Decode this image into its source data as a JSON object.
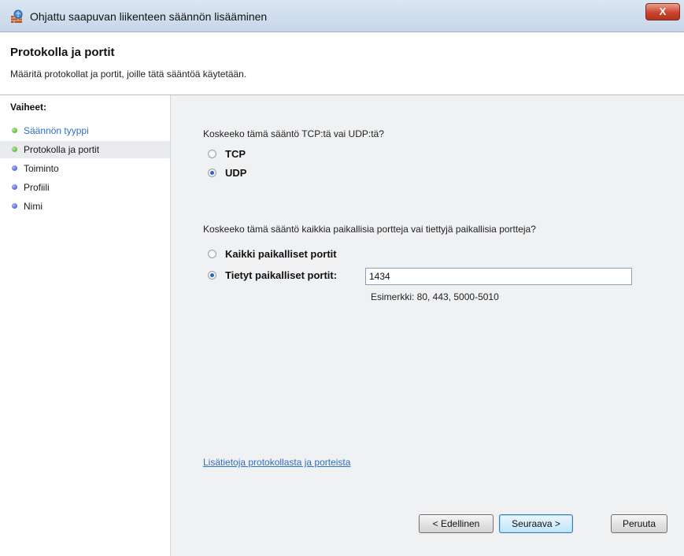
{
  "window": {
    "title": "Ohjattu saapuvan liikenteen säännön lisääminen",
    "close_glyph": "X"
  },
  "header": {
    "title": "Protokolla ja portit",
    "subtitle": "Määritä protokollat ja portit, joille tätä sääntöä käytetään."
  },
  "sidebar": {
    "heading": "Vaiheet:",
    "items": [
      {
        "label": "Säännön tyyppi",
        "status": "done",
        "dot_color": "#3aa31a"
      },
      {
        "label": "Protokolla ja portit",
        "status": "current",
        "dot_color": "#3aa31a"
      },
      {
        "label": "Toiminto",
        "status": "pending",
        "dot_color": "#3444c8"
      },
      {
        "label": "Profiili",
        "status": "pending",
        "dot_color": "#3444c8"
      },
      {
        "label": "Nimi",
        "status": "pending",
        "dot_color": "#3444c8"
      }
    ]
  },
  "main": {
    "protocol_question": "Koskeeko tämä sääntö TCP:tä vai UDP:tä?",
    "protocol_options": [
      {
        "label": "TCP",
        "checked": false
      },
      {
        "label": "UDP",
        "checked": true
      }
    ],
    "ports_question": "Koskeeko tämä sääntö kaikkia paikallisia portteja vai tiettyjä paikallisia portteja?",
    "port_options": [
      {
        "label": "Kaikki paikalliset portit",
        "checked": false
      },
      {
        "label": "Tietyt paikalliset portit:",
        "checked": true
      }
    ],
    "ports_value": "1434",
    "example": "Esimerkki: 80, 443, 5000-5010",
    "more_info_link": "Lisätietoja protokollasta ja porteista"
  },
  "buttons": {
    "back": "< Edellinen",
    "next": "Seuraava >",
    "cancel": "Peruuta"
  },
  "colors": {
    "link": "#2f6fbf",
    "content_bg": "#f0f1f3",
    "close_button": "#c9452d"
  }
}
